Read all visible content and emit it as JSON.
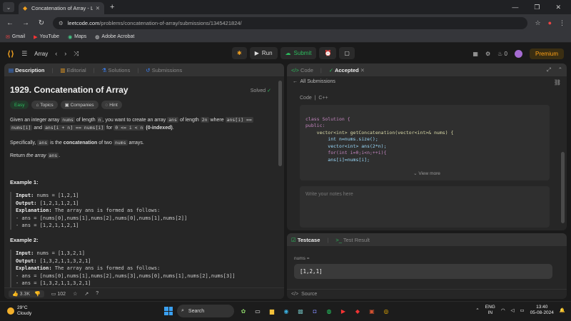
{
  "browser": {
    "tab_title": "Concatenation of Array - LeetC",
    "address_host": "leetcode.com",
    "address_path": "/problems/concatenation-of-array/submissions/1345421824/",
    "bookmarks": [
      "Gmail",
      "YouTube",
      "Maps",
      "Adobe Acrobat"
    ]
  },
  "lcnav": {
    "problem_list_label": "Array",
    "run_label": "Run",
    "submit_label": "Submit",
    "streak_count": "0",
    "premium_label": "Premium"
  },
  "left_tabs": [
    "Description",
    "Editorial",
    "Solutions",
    "Submissions"
  ],
  "problem": {
    "title": "1929. Concatenation of Array",
    "status": "Solved",
    "chips": [
      "Easy",
      "Topics",
      "Companies",
      "Hint"
    ],
    "desc_1a": "Given an integer array",
    "desc_1b": "nums",
    "desc_1c": "of length",
    "desc_1d": "n",
    "desc_1e": ", you want to create an array",
    "desc_1f": "ans",
    "desc_1g": "of length",
    "desc_1h": "2n",
    "desc_1i": "where",
    "desc_1j": "ans[i] ==",
    "desc_1k": "nums[i]",
    "desc_1l": "and",
    "desc_1m": "ans[i + n] == nums[i]",
    "desc_1n": "for",
    "desc_1o": "0 <= i < n",
    "desc_1p": "(0-indexed)",
    "desc_2a": "Specifically,",
    "desc_2b": "ans",
    "desc_2c": "is the",
    "desc_2d": "concatenation",
    "desc_2e": "of two",
    "desc_2f": "nums",
    "desc_2g": "arrays.",
    "desc_3a": "Return",
    "desc_3b": "the array",
    "desc_3c": "ans",
    "example1_title": "Example 1:",
    "example1": {
      "input_label": "Input:",
      "input": "nums = [1,2,1]",
      "output_label": "Output:",
      "output": "[1,2,1,1,2,1]",
      "expl_label": "Explanation:",
      "expl": "The array ans is formed as follows:",
      "line1": "- ans = [nums[0],nums[1],nums[2],nums[0],nums[1],nums[2]]",
      "line2": "- ans = [1,2,1,1,2,1]"
    },
    "example2_title": "Example 2:",
    "example2": {
      "input_label": "Input:",
      "input": "nums = [1,3,2,1]",
      "output_label": "Output:",
      "output": "[1,3,2,1,1,3,2,1]",
      "expl_label": "Explanation:",
      "expl": "The array ans is formed as follows:",
      "line1": "- ans = [nums[0],nums[1],nums[2],nums[3],nums[0],nums[1],nums[2],nums[3]]",
      "line2": "- ans = [1,3,2,1,1,3,2,1]"
    },
    "likes": "3.3K",
    "comments": "102"
  },
  "code_panel": {
    "tab_code": "Code",
    "tab_accepted": "Accepted",
    "all_submissions": "All Submissions",
    "code_label": "Code",
    "language": "C++",
    "code_lines": [
      "class Solution {",
      "public:",
      "    vector<int> getConcatenation(vector<int>& nums) {",
      "        int n=nums.size();",
      "        vector<int> ans(2*n);",
      "        for(int i=0;i<n;++i){",
      "",
      "        ans[i]=nums[i];"
    ],
    "view_more": "View more",
    "notes_placeholder": "Write your notes here"
  },
  "test_panel": {
    "tab_testcase": "Testcase",
    "tab_result": "Test Result",
    "input_label": "nums =",
    "input_value": "[1,2,1]",
    "source_label": "Source"
  },
  "taskbar": {
    "temp": "29°C",
    "condition": "Cloudy",
    "search_label": "Search",
    "lang_top": "ENG",
    "lang_bottom": "IN",
    "time": "13:40",
    "date": "05-08-2024"
  },
  "colors": {
    "accent_green": "#2cbb5d",
    "leetcode_orange": "#ffa116",
    "panel_bg": "#262626"
  }
}
